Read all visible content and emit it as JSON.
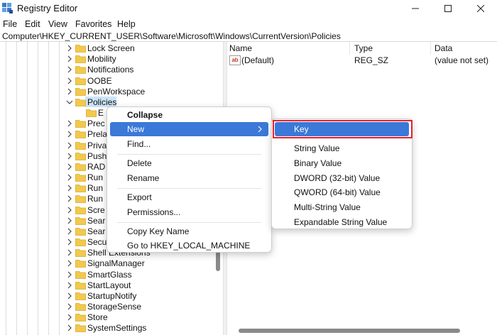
{
  "window": {
    "title": "Registry Editor",
    "icon": "registry-icon",
    "controls": [
      "minimize-icon",
      "maximize-icon",
      "close-icon"
    ]
  },
  "menu": [
    "File",
    "Edit",
    "View",
    "Favorites",
    "Help"
  ],
  "address": "Computer\\HKEY_CURRENT_USER\\Software\\Microsoft\\Windows\\CurrentVersion\\Policies",
  "tree": {
    "items": [
      {
        "label": "Lock Screen"
      },
      {
        "label": "Mobility"
      },
      {
        "label": "Notifications"
      },
      {
        "label": "OOBE"
      },
      {
        "label": "PenWorkspace"
      },
      {
        "label": "Policies",
        "expanded": true,
        "selected": true
      },
      {
        "label": "E",
        "child": true
      },
      {
        "label": "Prec"
      },
      {
        "label": "Prela"
      },
      {
        "label": "Priva"
      },
      {
        "label": "Push"
      },
      {
        "label": "RAD"
      },
      {
        "label": "Run"
      },
      {
        "label": "Run"
      },
      {
        "label": "Run"
      },
      {
        "label": "Scre"
      },
      {
        "label": "Sear"
      },
      {
        "label": "Sear"
      },
      {
        "label": "Secu"
      },
      {
        "label": "Shell Extensions"
      },
      {
        "label": "SignalManager"
      },
      {
        "label": "SmartGlass"
      },
      {
        "label": "StartLayout"
      },
      {
        "label": "StartupNotify"
      },
      {
        "label": "StorageSense"
      },
      {
        "label": "Store"
      },
      {
        "label": "SystemSettings"
      }
    ]
  },
  "list": {
    "columns": [
      "Name",
      "Type",
      "Data"
    ],
    "rows": [
      {
        "name": "(Default)",
        "type": "REG_SZ",
        "data": "(value not set)",
        "icon": "string-value-icon"
      }
    ]
  },
  "context_menu": {
    "items": [
      {
        "label": "Collapse",
        "bold": true
      },
      {
        "label": "New",
        "highlighted": true,
        "submenu": true
      },
      {
        "label": "Find..."
      },
      {
        "label": "Delete"
      },
      {
        "label": "Rename"
      },
      {
        "label": "Export"
      },
      {
        "label": "Permissions..."
      },
      {
        "label": "Copy Key Name"
      },
      {
        "label": "Go to HKEY_LOCAL_MACHINE"
      }
    ]
  },
  "new_submenu": {
    "items": [
      {
        "label": "Key",
        "highlighted": true,
        "outlined": true
      },
      {
        "label": "String Value"
      },
      {
        "label": "Binary Value"
      },
      {
        "label": "DWORD (32-bit) Value"
      },
      {
        "label": "QWORD (64-bit) Value"
      },
      {
        "label": "Multi-String Value"
      },
      {
        "label": "Expandable String Value"
      }
    ]
  },
  "colors": {
    "highlight": "#3b78d8",
    "outline": "#e5212b",
    "folder": "#f2c94c",
    "selected_tree": "#cce4f7"
  }
}
